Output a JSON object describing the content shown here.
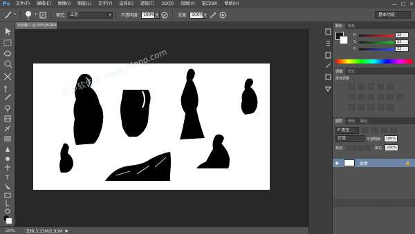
{
  "menubar": {
    "logo": "Ps",
    "items": [
      "文件(F)",
      "编辑(E)",
      "图像(I)",
      "图层(L)",
      "文字(Y)",
      "选择(S)",
      "滤镜(T)",
      "3D(D)",
      "视图(V)",
      "窗口(W)",
      "帮助(H)"
    ],
    "window_buttons": [
      "—",
      "□",
      "✕"
    ]
  },
  "options": {
    "brush_size": "1",
    "mode_label": "模式:",
    "mode_value": "正常",
    "opacity_label": "不透明度:",
    "opacity_value": "100%",
    "flow_label": "流量:",
    "flow_value": "100%",
    "workspace": "基本功能"
  },
  "document": {
    "tab_title": "未标题-1 @ 50%(RGB/8) *"
  },
  "status": {
    "zoom": "50%",
    "doc_info": "文档:3.33M/2.93M"
  },
  "color_panel": {
    "tabs": [
      "颜色",
      "色板"
    ],
    "channels": [
      {
        "label": "R",
        "value": "22",
        "color": "#e03030"
      },
      {
        "label": "G",
        "value": "22",
        "color": "#30c030"
      },
      {
        "label": "B",
        "value": "22",
        "color": "#3050e0"
      }
    ]
  },
  "adjust_panel": {
    "tabs": [
      "调整",
      "样式"
    ],
    "title": "添加调整"
  },
  "layers_panel": {
    "tabs": [
      "图层",
      "通道",
      "路径"
    ],
    "kind_label": "P 类型",
    "blend_mode": "正常",
    "opacity_label": "不透明度:",
    "opacity_value": "100%",
    "lock_label": "锁定:",
    "fill_label": "填充:",
    "fill_value": "100%",
    "layer_name": "背景"
  },
  "watermark": "多多软件站 www.ddooo.com"
}
